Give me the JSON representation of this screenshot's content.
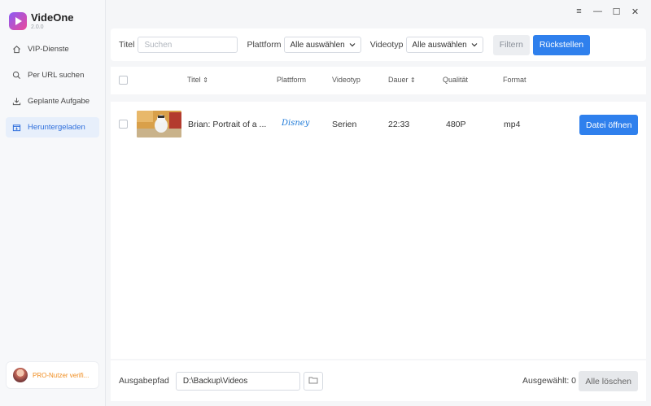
{
  "app": {
    "name": "VideOne",
    "version": "2.0.0"
  },
  "window_controls": {
    "menu": "≡",
    "minimize": "—",
    "maximize": "☐",
    "close": "✕"
  },
  "sidebar": {
    "items": [
      {
        "label": "VIP-Dienste",
        "icon": "home-icon",
        "active": false
      },
      {
        "label": "Per URL suchen",
        "icon": "search-icon",
        "active": false
      },
      {
        "label": "Geplante Aufgabe",
        "icon": "download-icon",
        "active": false
      },
      {
        "label": "Heruntergeladen",
        "icon": "downloaded-box-icon",
        "active": true
      }
    ],
    "pro_status": "PRO-Nutzer verifi..."
  },
  "filters": {
    "title_label": "Titel",
    "title_placeholder": "Suchen",
    "platform_label": "Plattform",
    "platform_value": "Alle auswählen",
    "type_label": "Videotyp",
    "type_value": "Alle auswählen",
    "filter_button": "Filtern",
    "reset_button": "Rückstellen"
  },
  "table": {
    "headers": {
      "title": "Titel",
      "platform": "Plattform",
      "type": "Videotyp",
      "duration": "Dauer",
      "quality": "Qualität",
      "format": "Format"
    },
    "rows": [
      {
        "title": "Brian: Portrait of a ...",
        "platform": "Disney",
        "type": "Serien",
        "duration": "22:33",
        "quality": "480P",
        "format": "mp4",
        "action": "Datei öffnen"
      }
    ]
  },
  "footer": {
    "path_label": "Ausgabepfad",
    "path_value": "D:\\Backup\\Videos",
    "selected_label": "Ausgewählt: 0",
    "clear_button": "Alle löschen"
  },
  "colors": {
    "accent": "#2f80ed",
    "pro": "#f08c1e",
    "active_bg": "#e7effb"
  }
}
